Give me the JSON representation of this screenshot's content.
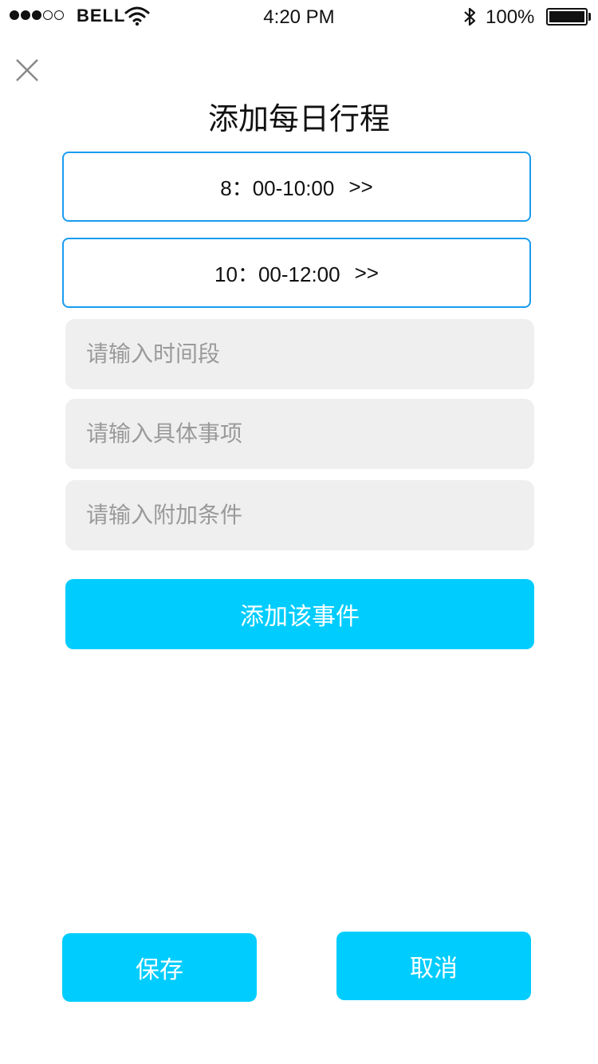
{
  "status_bar": {
    "carrier": "BELL",
    "time": "4:20 PM",
    "battery": "100%",
    "signal_bars_filled": 3,
    "signal_bars_total": 5
  },
  "header": {
    "title": "添加每日行程",
    "close_icon": "close-icon"
  },
  "time_slots": [
    {
      "label": "8：00-10:00",
      "arrow": ">>"
    },
    {
      "label": "10：00-12:00",
      "arrow": ">>"
    }
  ],
  "form": {
    "period_placeholder": "请输入时间段",
    "detail_placeholder": "请输入具体事项",
    "condition_placeholder": "请输入附加条件",
    "add_event_label": "添加该事件"
  },
  "footer": {
    "save_label": "保存",
    "cancel_label": "取消"
  },
  "colors": {
    "accent": "#00cdfe",
    "slot_border": "#1a9cf0",
    "input_bg": "#efefef",
    "placeholder": "#9a9a9a"
  }
}
